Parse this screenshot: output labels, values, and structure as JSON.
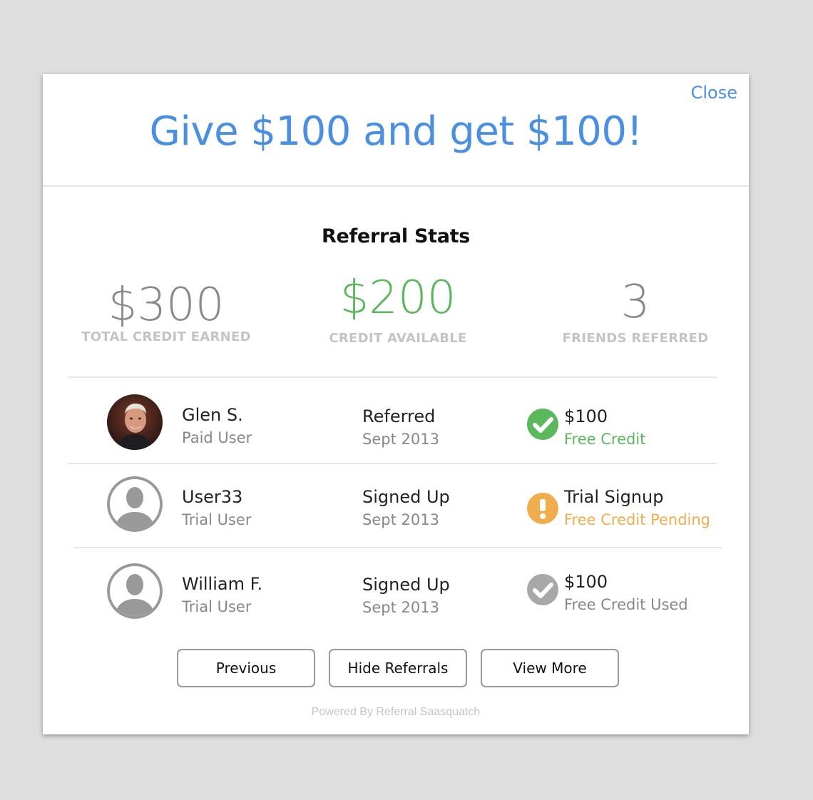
{
  "close_label": "Close",
  "headline": "Give $100 and get $100!",
  "stats": {
    "title": "Referral Stats",
    "total_credit": {
      "value": "$300",
      "label": "TOTAL CREDIT EARNED"
    },
    "credit_available": {
      "value": "$200",
      "label": "CREDIT AVAILABLE"
    },
    "friends_referred": {
      "value": "3",
      "label": "FRIENDS REFERRED"
    }
  },
  "referrals": [
    {
      "name": "Glen S.",
      "user_type": "Paid User",
      "avatar": "photo-avatar",
      "status": "Referred",
      "date": "Sept 2013",
      "reward_icon": "check-circle-icon",
      "reward_title": "$100",
      "reward_sub": "Free Credit",
      "reward_color": "#5cb85c"
    },
    {
      "name": "User33",
      "user_type": "Trial User",
      "avatar": "default-user-icon",
      "status": "Signed Up",
      "date": "Sept 2013",
      "reward_icon": "exclamation-circle-icon",
      "reward_title": "Trial Signup",
      "reward_sub": "Free Credit Pending",
      "reward_color": "#f0ad4e"
    },
    {
      "name": "William F.",
      "user_type": "Trial User",
      "avatar": "default-user-icon",
      "status": "Signed Up",
      "date": "Sept 2013",
      "reward_icon": "check-circle-icon",
      "reward_title": "$100",
      "reward_sub": "Free Credit Used",
      "reward_color": "#a8a8a8"
    }
  ],
  "buttons": {
    "previous": "Previous",
    "hide": "Hide Referrals",
    "view_more": "View More"
  },
  "footer": "Powered By Referral Saasquatch",
  "colors": {
    "accent": "#4a8fe0",
    "success": "#5cb85c",
    "warning": "#f0ad4e",
    "muted": "#a8a8a8"
  }
}
